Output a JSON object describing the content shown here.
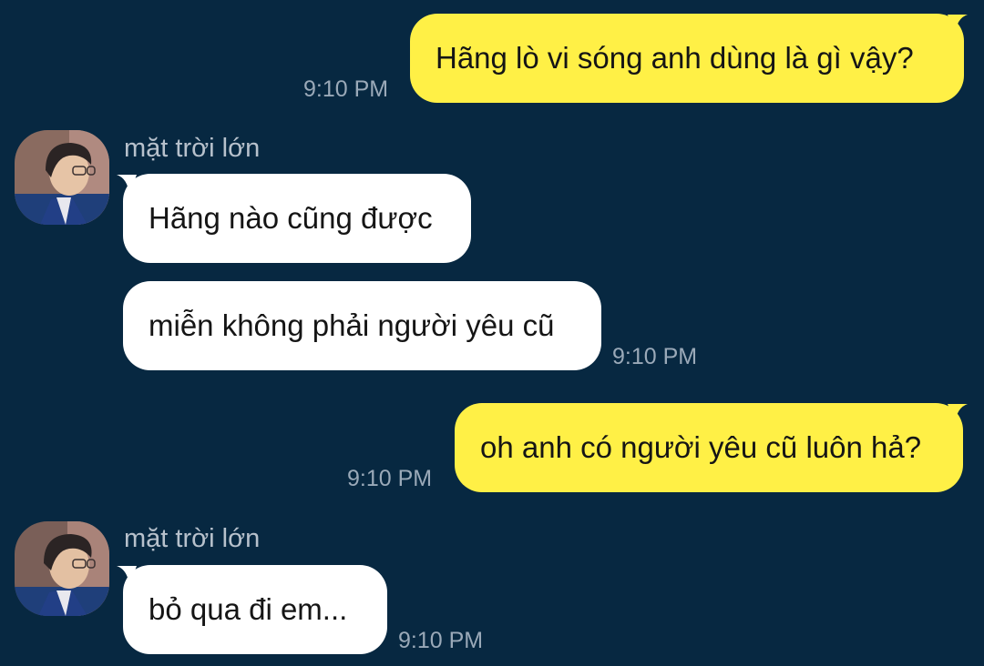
{
  "colors": {
    "background": "#072841",
    "outgoing_bubble": "#fff046",
    "incoming_bubble": "#ffffff",
    "timestamp": "#9aa9b8",
    "sender_name": "#b7c1cc"
  },
  "messages": [
    {
      "direction": "outgoing",
      "text": "Hãng lò vi sóng anh dùng là gì vậy?",
      "time": "9:10 PM"
    },
    {
      "direction": "incoming",
      "sender": "mặt trời lớn",
      "avatar_icon": "user-avatar-icon",
      "text": "Hãng nào cũng được"
    },
    {
      "direction": "incoming",
      "text": "miễn không phải người yêu cũ",
      "time": "9:10 PM"
    },
    {
      "direction": "outgoing",
      "text": "oh anh có người yêu cũ luôn hả?",
      "time": "9:10 PM"
    },
    {
      "direction": "incoming",
      "sender": "mặt trời lớn",
      "avatar_icon": "user-avatar-icon",
      "text": "bỏ qua đi em...",
      "time": "9:10 PM"
    }
  ]
}
